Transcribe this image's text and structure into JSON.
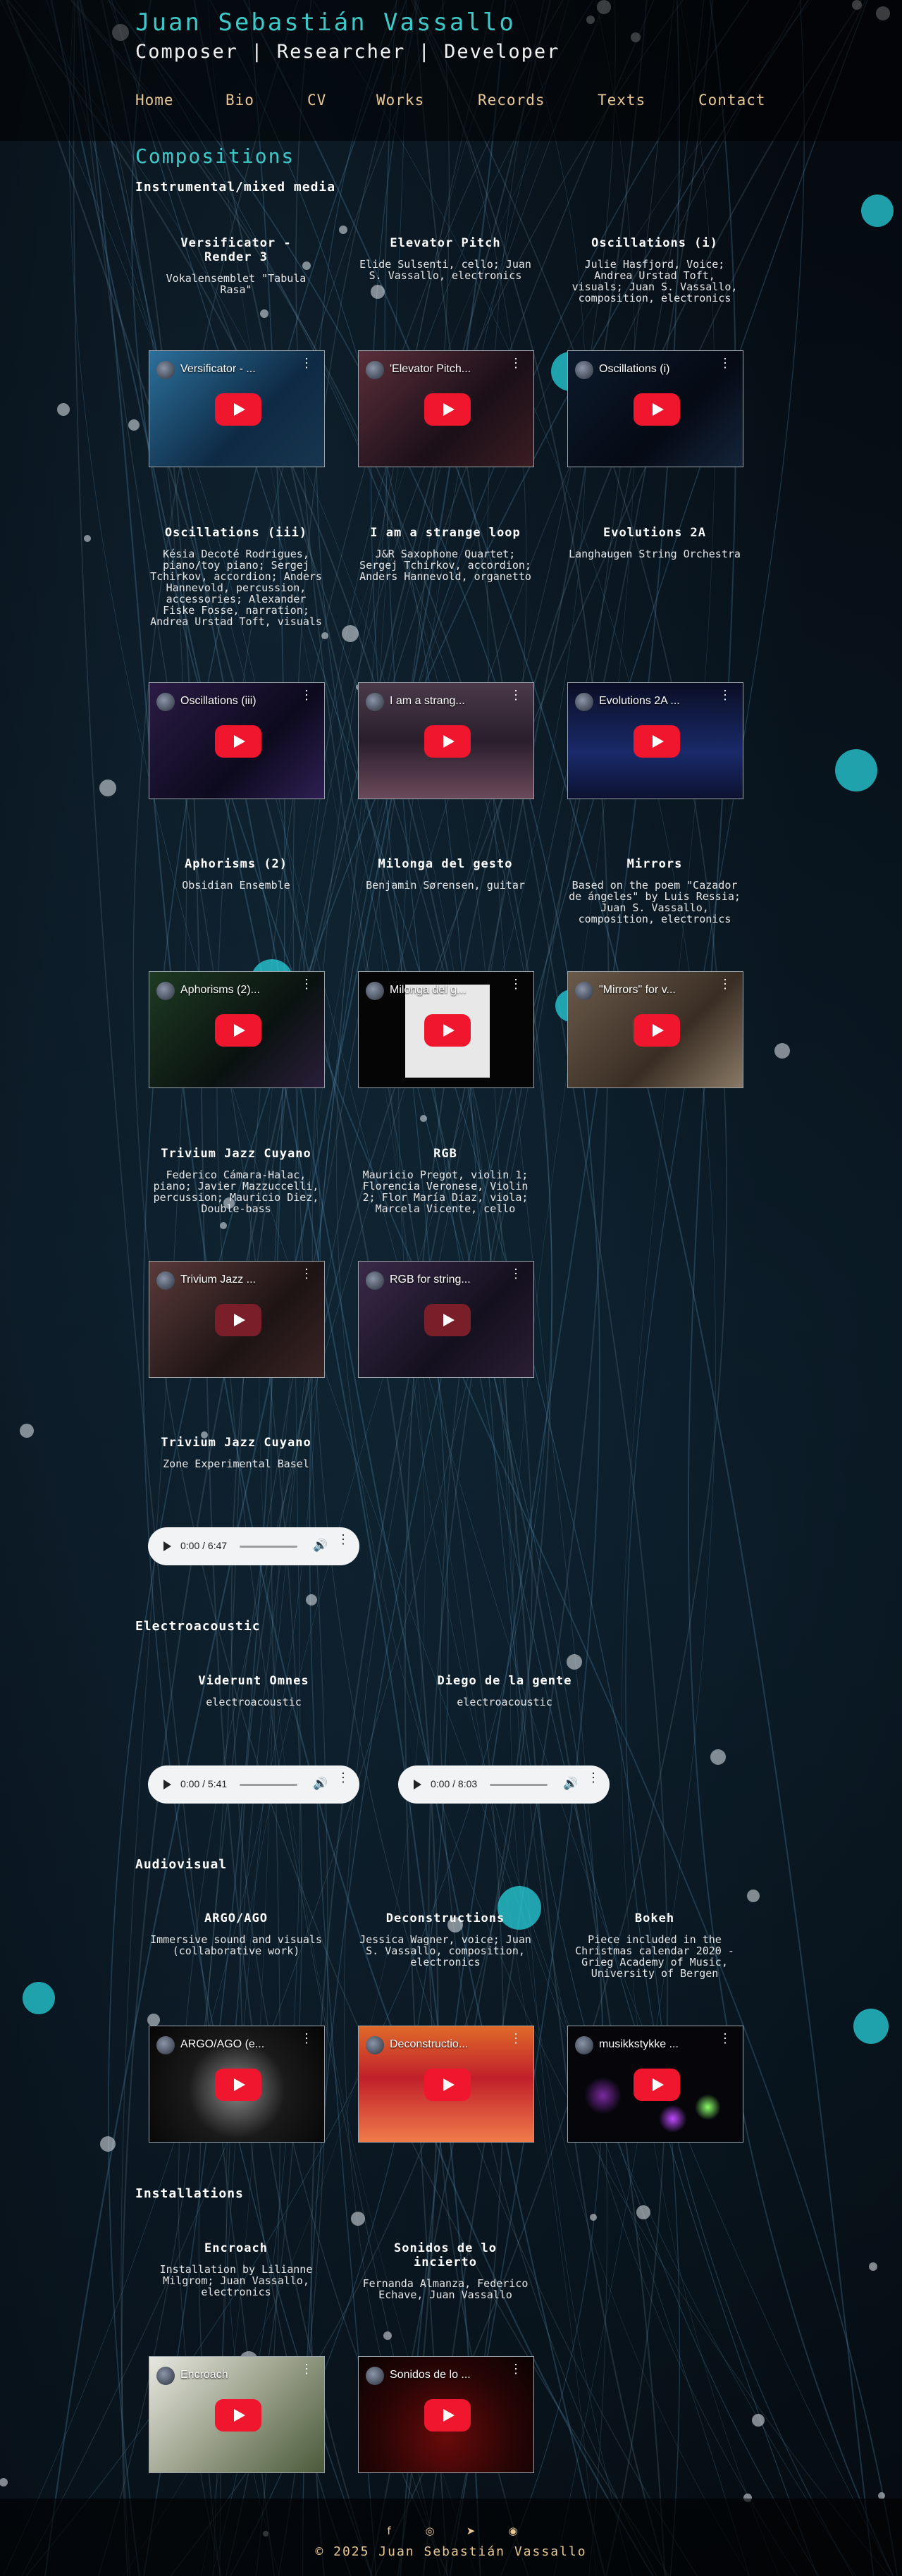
{
  "site": {
    "title": "Juan Sebastián Vassallo",
    "tagline": "Composer | Researcher | Developer"
  },
  "nav": [
    "Home",
    "Bio",
    "CV",
    "Works",
    "Records",
    "Texts",
    "Contact"
  ],
  "section_title": "Compositions",
  "categories": {
    "instrumental": "Instrumental/mixed media",
    "electroacoustic": "Electroacoustic",
    "audiovisual": "Audiovisual",
    "installations": "Installations"
  },
  "works": {
    "versificator": {
      "title": "Versificator - Render 3",
      "desc": "Vokalensemblet \"Tabula Rasa\"",
      "video_title": "Versificator - ..."
    },
    "elevator": {
      "title": "Elevator Pitch",
      "desc": "Elide Sulsenti, cello; Juan S. Vassallo, electronics",
      "video_title": "'Elevator Pitch..."
    },
    "osc1": {
      "title": "Oscillations (i)",
      "desc": "Julie Hasfjord, Voice; Andrea Urstad Toft, visuals; Juan S. Vassallo, composition, electronics",
      "video_title": "Oscillations (i)"
    },
    "osc3": {
      "title": "Oscillations (iii)",
      "desc": "Késia Decoté Rodrigues, piano/toy piano; Sergej Tchirkov, accordion; Anders Hannevold, percussion, accessories; Alexander Fiske Fosse, narration; Andrea Urstad Toft, visuals",
      "video_title": "Oscillations (iii)"
    },
    "strange": {
      "title": "I am a strange loop",
      "desc": "J&R Saxophone Quartet; Sergej Tchirkov, accordion; Anders Hannevold, organetto",
      "video_title": "I am a strang..."
    },
    "evolutions": {
      "title": "Evolutions 2A",
      "desc": "Langhaugen String Orchestra",
      "video_title": "Evolutions 2A ..."
    },
    "aphorisms": {
      "title": "Aphorisms (2)",
      "desc": "Obsidian Ensemble",
      "video_title": "Aphorisms (2)..."
    },
    "milonga": {
      "title": "Milonga del gesto",
      "desc": "Benjamin Sørensen, guitar",
      "video_title": "Milonga del g..."
    },
    "mirrors": {
      "title": "Mirrors",
      "desc": "Based on the poem \"Cazador de ángeles\" by Luis Ressia; Juan S. Vassallo, composition, electronics",
      "video_title": "\"Mirrors\" for v..."
    },
    "trivium1": {
      "title": "Trivium Jazz Cuyano",
      "desc": "Federico Cámara-Halac, piano; Javier Mazzuccelli, percussion; Mauricio Diez, Double-bass",
      "video_title": "Trivium Jazz ..."
    },
    "rgb": {
      "title": "RGB",
      "desc": "Mauricio Pregot, violin 1; Florencia Veronese, Violin 2; Flor María Díaz, viola; Marcela Vicente, cello",
      "video_title": "RGB for string..."
    },
    "trivium2": {
      "title": "Trivium Jazz Cuyano",
      "desc": "Zone Experimental Basel",
      "audio_time": "0:00 / 6:47"
    },
    "viderunt": {
      "title": "Viderunt Omnes",
      "desc": "electroacoustic",
      "audio_time": "0:00 / 5:41"
    },
    "diego": {
      "title": "Diego de la gente",
      "desc": "electroacoustic",
      "audio_time": "0:00 / 8:03"
    },
    "argo": {
      "title": "ARGO/AGO",
      "desc": "Immersive sound and visuals (collaborative work)",
      "video_title": "ARGO/AGO (e..."
    },
    "decon": {
      "title": "Deconstructions",
      "desc": "Jessica Wagner, voice; Juan S. Vassallo, composition, electronics",
      "video_title": "Deconstructio..."
    },
    "bokeh": {
      "title": "Bokeh",
      "desc": "Piece included in the Christmas calendar 2020 - Grieg Academy of Music, University of Bergen",
      "video_title": "musikkstykke ..."
    },
    "encroach": {
      "title": "Encroach",
      "desc": "Installation by Lilianne Milgrom; Juan Vassallo, electronics",
      "video_title": "Encroach"
    },
    "sonidos": {
      "title": "Sonidos de lo incierto",
      "desc": "Fernanda Almanza, Federico Echave, Juan Vassallo",
      "video_title": "Sonidos de lo ..."
    }
  },
  "social": {
    "facebook": "f",
    "instagram": "◎",
    "twitter": "➤",
    "other": "◉"
  },
  "footer": "© 2025 Juan Sebastián Vassallo"
}
